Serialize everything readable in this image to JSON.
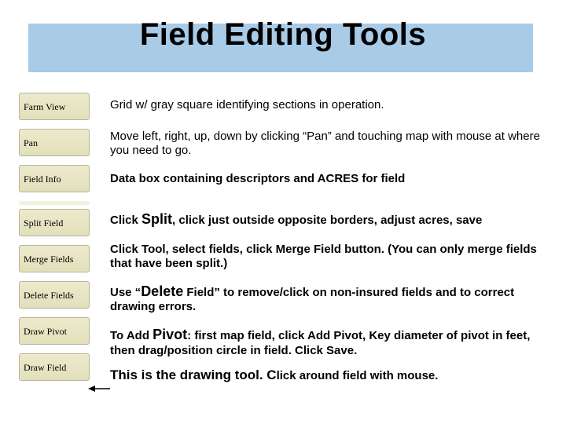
{
  "title": "Field Editing Tools",
  "toolbar": {
    "items": [
      {
        "label": "Farm View"
      },
      {
        "label": "Pan"
      },
      {
        "label": "Field Info"
      },
      {
        "label": ""
      },
      {
        "label": "Split Field"
      },
      {
        "label": "Merge Fields"
      },
      {
        "label": "Delete Fields"
      },
      {
        "label": "Draw Pivot"
      },
      {
        "label": "Draw Field"
      }
    ]
  },
  "descriptions": {
    "farm_view": "Grid w/ gray square identifying sections in operation.",
    "pan": "Move left, right, up, down by clicking “Pan” and touching map with mouse at where you need to go.",
    "field_info": "Data box containing descriptors and ACRES for field",
    "split_pre": "Click ",
    "split_word": "Split",
    "split_post": ", click just outside opposite borders, adjust acres, save",
    "merge": "Click Tool, select fields, click Merge Field button. (You can only merge fields that have been split.)",
    "delete_pre": "Use “",
    "delete_word": "Delete",
    "delete_mid": " Field” to remove/click on non-insured fields and to correct drawing errors.",
    "pivot_pre": "To Add ",
    "pivot_word": "Pivot",
    "pivot_post": ": first map field, click Add Pivot,  Key diameter of pivot in feet, then drag/position circle in field. Click Save.",
    "draw_pre": "This is the drawing tool. C",
    "draw_post": "lick around field with mouse."
  }
}
